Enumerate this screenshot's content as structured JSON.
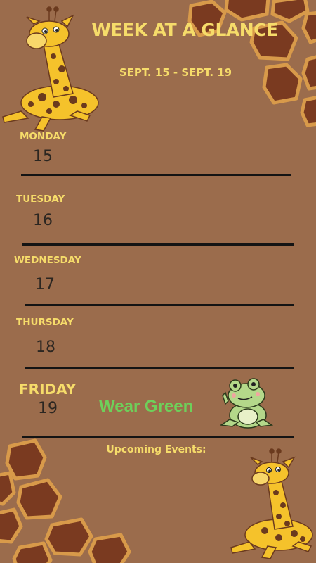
{
  "header": {
    "title": "WEEK AT A GLANCE",
    "date_range": "SEPT. 15 - SEPT. 19"
  },
  "days": [
    {
      "name": "MONDAY",
      "date": "15"
    },
    {
      "name": "TUESDAY",
      "date": "16"
    },
    {
      "name": "WEDNESDAY",
      "date": "17"
    },
    {
      "name": "THURSDAY",
      "date": "18"
    },
    {
      "name": "FRIDAY",
      "date": "19",
      "event": "Wear Green"
    }
  ],
  "footer": {
    "upcoming_label": "Upcoming Events:"
  },
  "colors": {
    "background": "#9b6c4c",
    "heading": "#f6dc6a",
    "event_text": "#6ed05a",
    "rule": "#141414"
  },
  "icons": [
    "giraffe-illustration",
    "frog-illustration",
    "giraffe-spot-pattern"
  ]
}
